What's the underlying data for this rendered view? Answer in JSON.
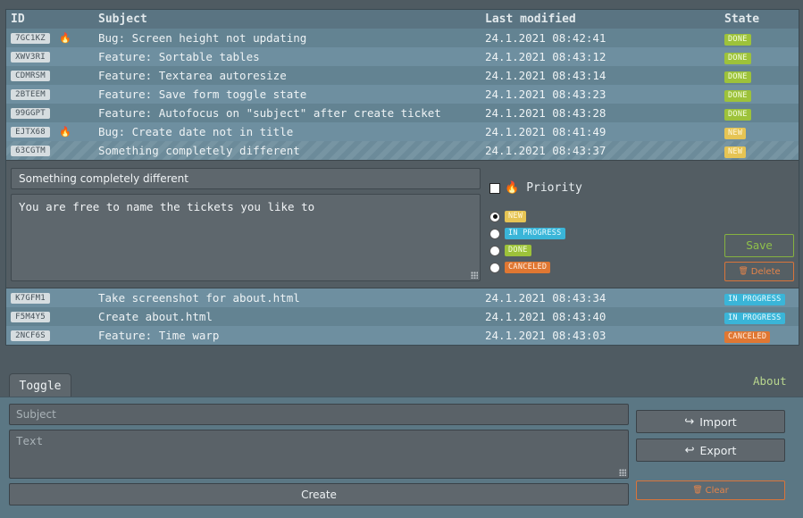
{
  "table": {
    "headers": {
      "id": "ID",
      "subject": "Subject",
      "modified": "Last modified",
      "state": "State"
    },
    "rows_top": [
      {
        "id": "7GC1KZ",
        "priority": true,
        "subject": "Bug: Screen height not updating",
        "modified": "24.1.2021 08:42:41",
        "state": "DONE",
        "state_class": "s-done"
      },
      {
        "id": "XWV3RI",
        "priority": false,
        "subject": "Feature: Sortable tables",
        "modified": "24.1.2021 08:43:12",
        "state": "DONE",
        "state_class": "s-done"
      },
      {
        "id": "CDMRSM",
        "priority": false,
        "subject": "Feature: Textarea autoresize",
        "modified": "24.1.2021 08:43:14",
        "state": "DONE",
        "state_class": "s-done"
      },
      {
        "id": "2BTEEM",
        "priority": false,
        "subject": "Feature: Save form toggle state",
        "modified": "24.1.2021 08:43:23",
        "state": "DONE",
        "state_class": "s-done"
      },
      {
        "id": "99GGPT",
        "priority": false,
        "subject": "Feature: Autofocus on \"subject\" after create ticket",
        "modified": "24.1.2021 08:43:28",
        "state": "DONE",
        "state_class": "s-done"
      },
      {
        "id": "EJTX68",
        "priority": true,
        "subject": "Bug: Create date not in title",
        "modified": "24.1.2021 08:41:49",
        "state": "NEW",
        "state_class": "s-new"
      },
      {
        "id": "63CGTM",
        "priority": false,
        "subject": "Something completely different",
        "modified": "24.1.2021 08:43:37",
        "state": "NEW",
        "state_class": "s-new",
        "selected": true
      }
    ],
    "rows_bottom": [
      {
        "id": "K7GFM1",
        "priority": false,
        "subject": "Take screenshot for about.html",
        "modified": "24.1.2021 08:43:34",
        "state": "IN PROGRESS",
        "state_class": "s-progress"
      },
      {
        "id": "F5M4Y5",
        "priority": false,
        "subject": "Create about.html",
        "modified": "24.1.2021 08:43:40",
        "state": "IN PROGRESS",
        "state_class": "s-progress"
      },
      {
        "id": "2NCF6S",
        "priority": false,
        "subject": "Feature: Time warp",
        "modified": "24.1.2021 08:43:03",
        "state": "CANCELED",
        "state_class": "s-canceled"
      }
    ]
  },
  "editor": {
    "subject_value": "Something completely different",
    "text_value": "You are free to name the tickets you like to",
    "priority_label": "Priority",
    "states": [
      {
        "label": "NEW",
        "class": "s-new",
        "checked": true
      },
      {
        "label": "IN PROGRESS",
        "class": "s-progress",
        "checked": false
      },
      {
        "label": "DONE",
        "class": "s-done",
        "checked": false
      },
      {
        "label": "CANCELED",
        "class": "s-canceled",
        "checked": false
      }
    ],
    "save_label": "Save",
    "delete_label": "Delete"
  },
  "bottom": {
    "toggle_label": "Toggle",
    "about_label": "About",
    "subject_placeholder": "Subject",
    "text_placeholder": "Text",
    "create_label": "Create",
    "import_label": "Import",
    "export_label": "Export",
    "clear_label": "Clear"
  },
  "colors": {
    "done": "#9dc23a",
    "new": "#e6c454",
    "in_progress": "#3ab5d8",
    "canceled": "#e07732",
    "priority_fire": "#ff6a1a",
    "save_green": "#86b240"
  },
  "icons": {
    "priority": "fire-icon",
    "import": "import-arrow-icon",
    "export": "export-arrow-icon",
    "delete": "trash-icon",
    "clear": "trash-icon"
  }
}
